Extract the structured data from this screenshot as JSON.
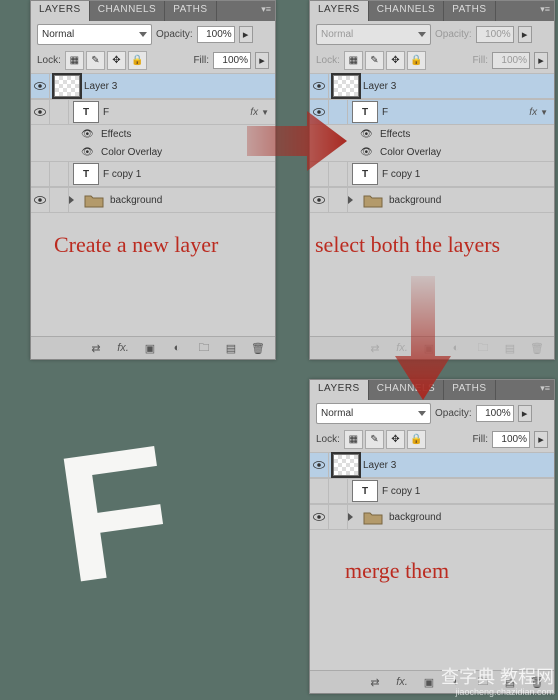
{
  "tabs": {
    "layers": "LAYERS",
    "channels": "CHANNELS",
    "paths": "PATHS"
  },
  "blend": {
    "normal": "Normal"
  },
  "labels": {
    "opacity": "Opacity:",
    "lock": "Lock:",
    "fill": "Fill:"
  },
  "pct100": "100%",
  "layers1": {
    "l3": "Layer 3",
    "f": "F",
    "effects": "Effects",
    "overlay": "Color Overlay",
    "fcopy": "F copy 1",
    "bg": "background",
    "fx": "fx"
  },
  "anno": {
    "create": "Create a new layer",
    "select": "select both the layers",
    "merge": "merge them"
  },
  "glyphs": {
    "T": "T"
  },
  "watermark": {
    "main": "查字典 教程网",
    "sub": "jiaocheng.chazidian.com"
  },
  "bigF": "F"
}
